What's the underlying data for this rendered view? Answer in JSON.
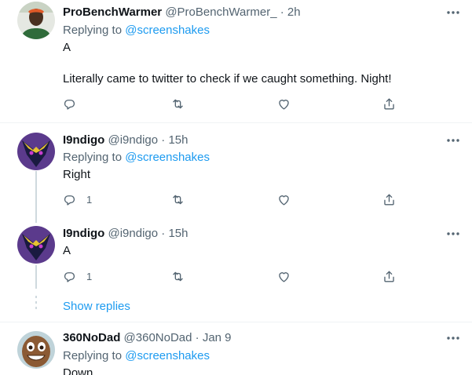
{
  "tweets": [
    {
      "name": "ProBenchWarmer",
      "handle": "@ProBenchWarmer_",
      "time": "· 2h",
      "replying_prefix": "Replying to",
      "replying_to": "@screenshakes",
      "line1": "A",
      "line2": "Literally came to twitter to check if we caught something. Night!",
      "reply_count": ""
    },
    {
      "name": "I9ndigo",
      "handle": "@i9ndigo",
      "time": "· 15h",
      "replying_prefix": "Replying to",
      "replying_to": "@screenshakes",
      "text": "Right",
      "reply_count": "1"
    },
    {
      "name": "I9ndigo",
      "handle": "@i9ndigo",
      "time": "· 15h",
      "text": "A",
      "reply_count": "1"
    },
    {
      "name": "360NoDad",
      "handle": "@360NoDad",
      "time": "· Jan 9",
      "replying_prefix": "Replying to",
      "replying_to": "@screenshakes",
      "text": "Down"
    }
  ],
  "show_replies_label": "Show replies",
  "colors": {
    "accent": "#1d9bf0",
    "muted": "#536471",
    "divider": "#eff3f4"
  },
  "icons": [
    "reply-icon",
    "retweet-icon",
    "like-icon",
    "share-icon",
    "more-icon"
  ]
}
